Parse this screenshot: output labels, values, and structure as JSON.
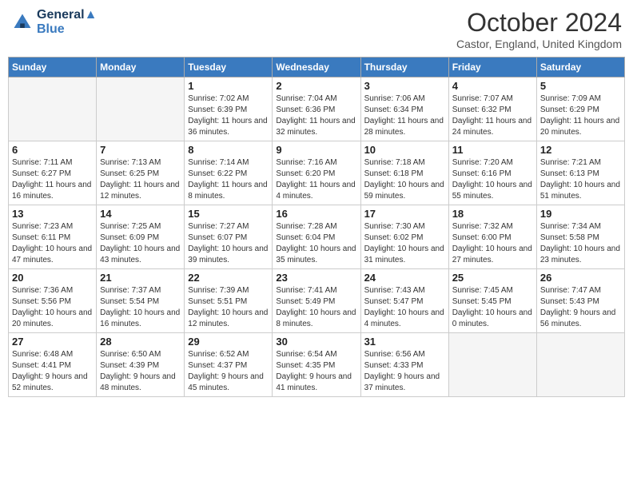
{
  "logo": {
    "line1": "General",
    "line2": "Blue"
  },
  "title": "October 2024",
  "location": "Castor, England, United Kingdom",
  "days_of_week": [
    "Sunday",
    "Monday",
    "Tuesday",
    "Wednesday",
    "Thursday",
    "Friday",
    "Saturday"
  ],
  "weeks": [
    [
      {
        "day": "",
        "empty": true
      },
      {
        "day": "",
        "empty": true
      },
      {
        "day": "1",
        "sunrise": "Sunrise: 7:02 AM",
        "sunset": "Sunset: 6:39 PM",
        "daylight": "Daylight: 11 hours and 36 minutes."
      },
      {
        "day": "2",
        "sunrise": "Sunrise: 7:04 AM",
        "sunset": "Sunset: 6:36 PM",
        "daylight": "Daylight: 11 hours and 32 minutes."
      },
      {
        "day": "3",
        "sunrise": "Sunrise: 7:06 AM",
        "sunset": "Sunset: 6:34 PM",
        "daylight": "Daylight: 11 hours and 28 minutes."
      },
      {
        "day": "4",
        "sunrise": "Sunrise: 7:07 AM",
        "sunset": "Sunset: 6:32 PM",
        "daylight": "Daylight: 11 hours and 24 minutes."
      },
      {
        "day": "5",
        "sunrise": "Sunrise: 7:09 AM",
        "sunset": "Sunset: 6:29 PM",
        "daylight": "Daylight: 11 hours and 20 minutes."
      }
    ],
    [
      {
        "day": "6",
        "sunrise": "Sunrise: 7:11 AM",
        "sunset": "Sunset: 6:27 PM",
        "daylight": "Daylight: 11 hours and 16 minutes."
      },
      {
        "day": "7",
        "sunrise": "Sunrise: 7:13 AM",
        "sunset": "Sunset: 6:25 PM",
        "daylight": "Daylight: 11 hours and 12 minutes."
      },
      {
        "day": "8",
        "sunrise": "Sunrise: 7:14 AM",
        "sunset": "Sunset: 6:22 PM",
        "daylight": "Daylight: 11 hours and 8 minutes."
      },
      {
        "day": "9",
        "sunrise": "Sunrise: 7:16 AM",
        "sunset": "Sunset: 6:20 PM",
        "daylight": "Daylight: 11 hours and 4 minutes."
      },
      {
        "day": "10",
        "sunrise": "Sunrise: 7:18 AM",
        "sunset": "Sunset: 6:18 PM",
        "daylight": "Daylight: 10 hours and 59 minutes."
      },
      {
        "day": "11",
        "sunrise": "Sunrise: 7:20 AM",
        "sunset": "Sunset: 6:16 PM",
        "daylight": "Daylight: 10 hours and 55 minutes."
      },
      {
        "day": "12",
        "sunrise": "Sunrise: 7:21 AM",
        "sunset": "Sunset: 6:13 PM",
        "daylight": "Daylight: 10 hours and 51 minutes."
      }
    ],
    [
      {
        "day": "13",
        "sunrise": "Sunrise: 7:23 AM",
        "sunset": "Sunset: 6:11 PM",
        "daylight": "Daylight: 10 hours and 47 minutes."
      },
      {
        "day": "14",
        "sunrise": "Sunrise: 7:25 AM",
        "sunset": "Sunset: 6:09 PM",
        "daylight": "Daylight: 10 hours and 43 minutes."
      },
      {
        "day": "15",
        "sunrise": "Sunrise: 7:27 AM",
        "sunset": "Sunset: 6:07 PM",
        "daylight": "Daylight: 10 hours and 39 minutes."
      },
      {
        "day": "16",
        "sunrise": "Sunrise: 7:28 AM",
        "sunset": "Sunset: 6:04 PM",
        "daylight": "Daylight: 10 hours and 35 minutes."
      },
      {
        "day": "17",
        "sunrise": "Sunrise: 7:30 AM",
        "sunset": "Sunset: 6:02 PM",
        "daylight": "Daylight: 10 hours and 31 minutes."
      },
      {
        "day": "18",
        "sunrise": "Sunrise: 7:32 AM",
        "sunset": "Sunset: 6:00 PM",
        "daylight": "Daylight: 10 hours and 27 minutes."
      },
      {
        "day": "19",
        "sunrise": "Sunrise: 7:34 AM",
        "sunset": "Sunset: 5:58 PM",
        "daylight": "Daylight: 10 hours and 23 minutes."
      }
    ],
    [
      {
        "day": "20",
        "sunrise": "Sunrise: 7:36 AM",
        "sunset": "Sunset: 5:56 PM",
        "daylight": "Daylight: 10 hours and 20 minutes."
      },
      {
        "day": "21",
        "sunrise": "Sunrise: 7:37 AM",
        "sunset": "Sunset: 5:54 PM",
        "daylight": "Daylight: 10 hours and 16 minutes."
      },
      {
        "day": "22",
        "sunrise": "Sunrise: 7:39 AM",
        "sunset": "Sunset: 5:51 PM",
        "daylight": "Daylight: 10 hours and 12 minutes."
      },
      {
        "day": "23",
        "sunrise": "Sunrise: 7:41 AM",
        "sunset": "Sunset: 5:49 PM",
        "daylight": "Daylight: 10 hours and 8 minutes."
      },
      {
        "day": "24",
        "sunrise": "Sunrise: 7:43 AM",
        "sunset": "Sunset: 5:47 PM",
        "daylight": "Daylight: 10 hours and 4 minutes."
      },
      {
        "day": "25",
        "sunrise": "Sunrise: 7:45 AM",
        "sunset": "Sunset: 5:45 PM",
        "daylight": "Daylight: 10 hours and 0 minutes."
      },
      {
        "day": "26",
        "sunrise": "Sunrise: 7:47 AM",
        "sunset": "Sunset: 5:43 PM",
        "daylight": "Daylight: 9 hours and 56 minutes."
      }
    ],
    [
      {
        "day": "27",
        "sunrise": "Sunrise: 6:48 AM",
        "sunset": "Sunset: 4:41 PM",
        "daylight": "Daylight: 9 hours and 52 minutes."
      },
      {
        "day": "28",
        "sunrise": "Sunrise: 6:50 AM",
        "sunset": "Sunset: 4:39 PM",
        "daylight": "Daylight: 9 hours and 48 minutes."
      },
      {
        "day": "29",
        "sunrise": "Sunrise: 6:52 AM",
        "sunset": "Sunset: 4:37 PM",
        "daylight": "Daylight: 9 hours and 45 minutes."
      },
      {
        "day": "30",
        "sunrise": "Sunrise: 6:54 AM",
        "sunset": "Sunset: 4:35 PM",
        "daylight": "Daylight: 9 hours and 41 minutes."
      },
      {
        "day": "31",
        "sunrise": "Sunrise: 6:56 AM",
        "sunset": "Sunset: 4:33 PM",
        "daylight": "Daylight: 9 hours and 37 minutes."
      },
      {
        "day": "",
        "empty": true
      },
      {
        "day": "",
        "empty": true
      }
    ]
  ]
}
